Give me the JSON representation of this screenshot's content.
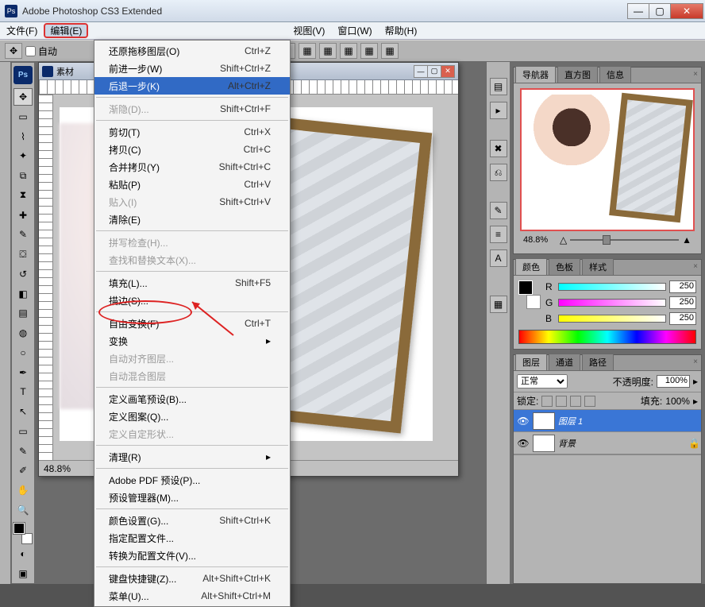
{
  "app": {
    "title": "Adobe Photoshop CS3 Extended"
  },
  "menubar": {
    "items": [
      {
        "label": "文件(F)"
      },
      {
        "label": "编辑(E)"
      },
      {
        "label": "视图(V)"
      },
      {
        "label": "窗口(W)"
      },
      {
        "label": "帮助(H)"
      }
    ]
  },
  "optionsbar": {
    "auto_label": "自动"
  },
  "edit_menu": {
    "groups": [
      [
        {
          "label": "还原拖移图层(O)",
          "shortcut": "Ctrl+Z"
        },
        {
          "label": "前进一步(W)",
          "shortcut": "Shift+Ctrl+Z"
        },
        {
          "label": "后退一步(K)",
          "shortcut": "Alt+Ctrl+Z",
          "highlight": true
        }
      ],
      [
        {
          "label": "渐隐(D)...",
          "shortcut": "Shift+Ctrl+F",
          "disabled": true
        }
      ],
      [
        {
          "label": "剪切(T)",
          "shortcut": "Ctrl+X"
        },
        {
          "label": "拷贝(C)",
          "shortcut": "Ctrl+C"
        },
        {
          "label": "合并拷贝(Y)",
          "shortcut": "Shift+Ctrl+C"
        },
        {
          "label": "粘贴(P)",
          "shortcut": "Ctrl+V"
        },
        {
          "label": "贴入(I)",
          "shortcut": "Shift+Ctrl+V",
          "disabled": true
        },
        {
          "label": "清除(E)",
          "shortcut": ""
        }
      ],
      [
        {
          "label": "拼写检查(H)...",
          "shortcut": "",
          "disabled": true
        },
        {
          "label": "查找和替换文本(X)...",
          "shortcut": "",
          "disabled": true
        }
      ],
      [
        {
          "label": "填充(L)...",
          "shortcut": "Shift+F5"
        },
        {
          "label": "描边(S)...",
          "shortcut": ""
        }
      ],
      [
        {
          "label": "自由变换(F)",
          "shortcut": "Ctrl+T"
        },
        {
          "label": "变换",
          "shortcut": "",
          "submenu": true
        },
        {
          "label": "自动对齐图层...",
          "shortcut": "",
          "disabled": true
        },
        {
          "label": "自动混合图层",
          "shortcut": "",
          "disabled": true
        }
      ],
      [
        {
          "label": "定义画笔预设(B)...",
          "shortcut": ""
        },
        {
          "label": "定义图案(Q)...",
          "shortcut": ""
        },
        {
          "label": "定义自定形状...",
          "shortcut": "",
          "disabled": true
        }
      ],
      [
        {
          "label": "清理(R)",
          "shortcut": "",
          "submenu": true
        }
      ],
      [
        {
          "label": "Adobe PDF 预设(P)...",
          "shortcut": ""
        },
        {
          "label": "预设管理器(M)...",
          "shortcut": ""
        }
      ],
      [
        {
          "label": "颜色设置(G)...",
          "shortcut": "Shift+Ctrl+K"
        },
        {
          "label": "指定配置文件...",
          "shortcut": ""
        },
        {
          "label": "转换为配置文件(V)...",
          "shortcut": ""
        }
      ],
      [
        {
          "label": "键盘快捷键(Z)...",
          "shortcut": "Alt+Shift+Ctrl+K"
        },
        {
          "label": "菜单(U)...",
          "shortcut": "Alt+Shift+Ctrl+M"
        }
      ]
    ]
  },
  "document": {
    "title": "素材",
    "zoom": "48.8%"
  },
  "panels": {
    "navigator": {
      "tabs": [
        "导航器",
        "直方图",
        "信息"
      ],
      "zoom": "48.8%"
    },
    "color": {
      "tabs": [
        "颜色",
        "色板",
        "样式"
      ],
      "channels": [
        {
          "label": "R",
          "value": "250"
        },
        {
          "label": "G",
          "value": "250"
        },
        {
          "label": "B",
          "value": "250"
        }
      ]
    },
    "layers": {
      "tabs": [
        "图层",
        "通道",
        "路径"
      ],
      "blend_mode": "正常",
      "opacity_label": "不透明度:",
      "opacity": "100%",
      "lock_label": "锁定:",
      "fill_label": "填充:",
      "fill": "100%",
      "items": [
        {
          "name": "图层 1",
          "selected": true,
          "visible": true
        },
        {
          "name": "背景",
          "selected": false,
          "visible": true,
          "locked": true
        }
      ]
    }
  }
}
